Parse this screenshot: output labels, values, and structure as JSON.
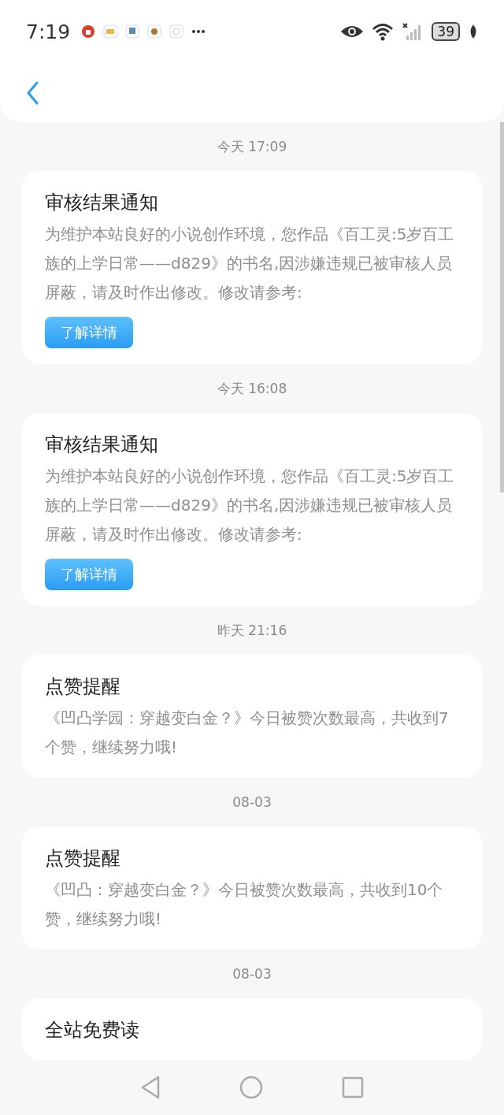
{
  "status_bar": {
    "time": "7:19",
    "battery": "39"
  },
  "messages": [
    {
      "time": "今天 17:09",
      "title": "审核结果通知",
      "body": "为维护本站良好的小说创作环境，您作品《百工灵:5岁百工族的上学日常——d829》的书名,因涉嫌违规已被审核人员屏蔽，请及时作出修改。修改请参考:",
      "button": "了解详情"
    },
    {
      "time": "今天 16:08",
      "title": "审核结果通知",
      "body": "为维护本站良好的小说创作环境，您作品《百工灵:5岁百工族的上学日常——d829》的书名,因涉嫌违规已被审核人员屏蔽，请及时作出修改。修改请参考:",
      "button": "了解详情"
    },
    {
      "time": "昨天 21:16",
      "title": "点赞提醒",
      "body": "《凹凸学园：穿越变白金？》今日被赞次数最高，共收到7个赞，继续努力哦!"
    },
    {
      "time": "08-03",
      "title": "点赞提醒",
      "body": "《凹凸：穿越变白金？》今日被赞次数最高，共收到10个赞，继续努力哦!"
    },
    {
      "time": "08-03",
      "title": "全站免费读"
    }
  ]
}
